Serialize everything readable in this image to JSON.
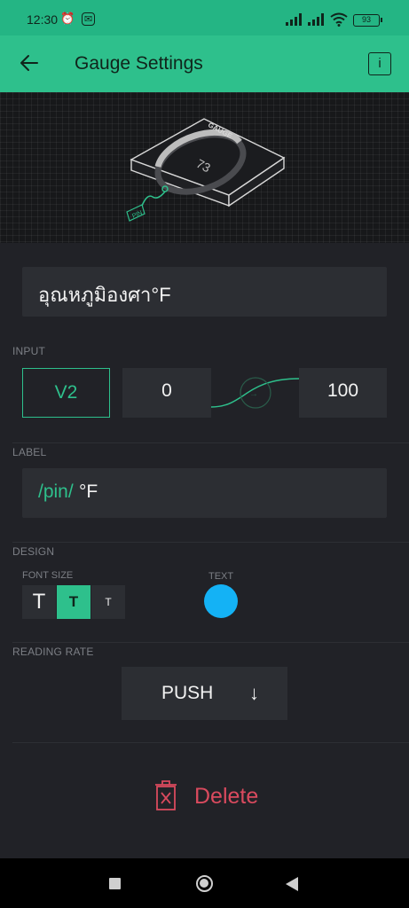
{
  "status_bar": {
    "time": "12:30",
    "battery": "93",
    "icons": [
      "alarm-icon",
      "notification-badge-icon",
      "signal-icon",
      "signal-icon",
      "wifi-icon",
      "battery-icon"
    ]
  },
  "appbar": {
    "title": "Gauge Settings",
    "back_icon": "arrow-left-icon",
    "info_label": "i"
  },
  "preview": {
    "widget_name": "GAUGE",
    "value": "73",
    "pin_label": "PIN"
  },
  "name_field": {
    "value": "อุณหภูมิองศา°F"
  },
  "input": {
    "section_label": "INPUT",
    "pin": "V2",
    "min": "0",
    "max": "100"
  },
  "label": {
    "section_label": "LABEL",
    "pin_part": "/pin/",
    "unit_part": "°F"
  },
  "design": {
    "section_label": "DESIGN",
    "font_size_label": "FONT SIZE",
    "font_sizes": [
      "T",
      "T",
      "T"
    ],
    "selected_font_size_index": 1,
    "text_label": "TEXT",
    "text_color": "#14b2f5"
  },
  "reading_rate": {
    "section_label": "READING RATE",
    "value": "PUSH",
    "arrow": "↓"
  },
  "delete": {
    "label": "Delete"
  },
  "colors": {
    "accent": "#2ec08c",
    "background": "#212227",
    "danger": "#d94a5e"
  }
}
